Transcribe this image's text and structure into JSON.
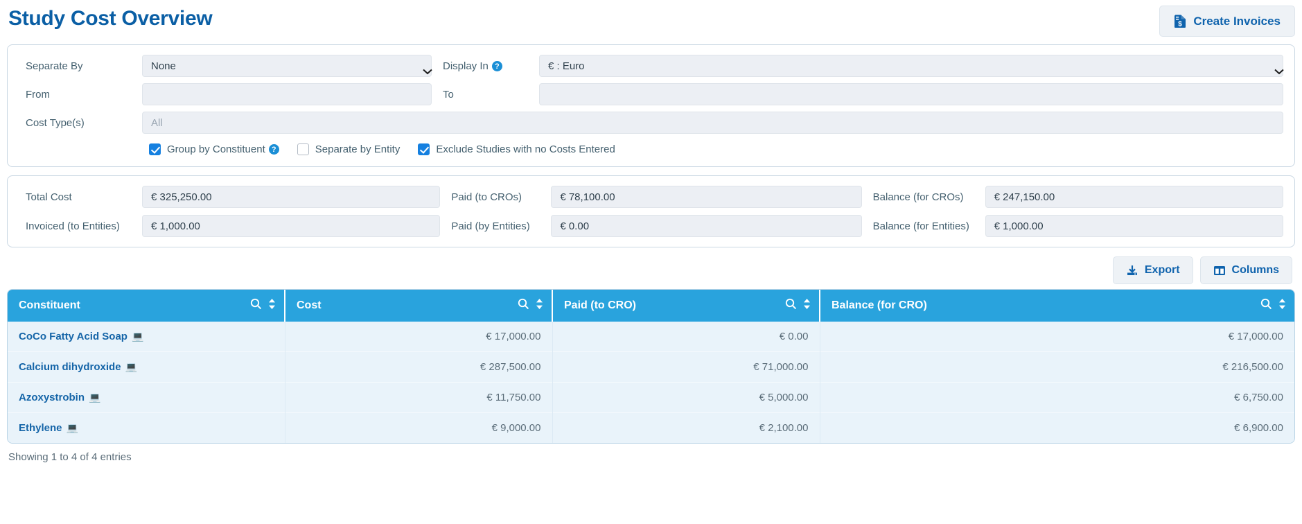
{
  "header": {
    "title": "Study Cost Overview",
    "create_invoices_label": "Create Invoices",
    "create_invoices_icon": "invoice-dollar-icon"
  },
  "filters": {
    "separate_by_label": "Separate By",
    "separate_by_value": "None",
    "display_in_label": "Display In",
    "display_in_help_icon": "help-circle-icon",
    "display_in_value": "€ : Euro",
    "from_label": "From",
    "from_value": "",
    "to_label": "To",
    "to_value": "",
    "cost_types_label": "Cost Type(s)",
    "cost_types_placeholder": "All",
    "checkboxes": [
      {
        "label": "Group by Constituent",
        "checked": true,
        "help": true
      },
      {
        "label": "Separate by Entity",
        "checked": false,
        "help": false
      },
      {
        "label": "Exclude Studies with no Costs Entered",
        "checked": true,
        "help": false
      }
    ]
  },
  "totals": {
    "rows": [
      [
        {
          "label": "Total Cost",
          "value": "€ 325,250.00"
        },
        {
          "label": "Paid (to CROs)",
          "value": "€ 78,100.00"
        },
        {
          "label": "Balance (for CROs)",
          "value": "€ 247,150.00"
        }
      ],
      [
        {
          "label": "Invoiced (to Entities)",
          "value": "€ 1,000.00"
        },
        {
          "label": "Paid (by Entities)",
          "value": "€ 0.00"
        },
        {
          "label": "Balance (for Entities)",
          "value": "€ 1,000.00"
        }
      ]
    ]
  },
  "toolbar": {
    "export_label": "Export",
    "export_icon": "download-icon",
    "columns_label": "Columns",
    "columns_icon": "columns-icon"
  },
  "table": {
    "columns": [
      {
        "label": "Constituent",
        "align": "left"
      },
      {
        "label": "Cost",
        "align": "right"
      },
      {
        "label": "Paid (to CRO)",
        "align": "right"
      },
      {
        "label": "Balance (for CRO)",
        "align": "right"
      }
    ],
    "row_icon": "laptop-icon",
    "row_icon_glyph": "💻",
    "rows": [
      {
        "constituent": "CoCo Fatty Acid Soap",
        "cost": "€ 17,000.00",
        "paid": "€ 0.00",
        "balance": "€ 17,000.00"
      },
      {
        "constituent": "Calcium dihydroxide",
        "cost": "€ 287,500.00",
        "paid": "€ 71,000.00",
        "balance": "€ 216,500.00"
      },
      {
        "constituent": "Azoxystrobin",
        "cost": "€ 11,750.00",
        "paid": "€ 5,000.00",
        "balance": "€ 6,750.00"
      },
      {
        "constituent": "Ethylene",
        "cost": "€ 9,000.00",
        "paid": "€ 2,100.00",
        "balance": "€ 6,900.00"
      }
    ],
    "header_search_icon": "search-icon",
    "header_sort_icon": "sort-icon",
    "footer_text": "Showing 1 to 4 of 4 entries"
  },
  "colors": {
    "title_blue": "#0b5fa5",
    "table_header_blue": "#29a3dd",
    "row_background": "#e9f3fa",
    "link_blue": "#1565a8",
    "accent_checkbox": "#1580e0"
  }
}
